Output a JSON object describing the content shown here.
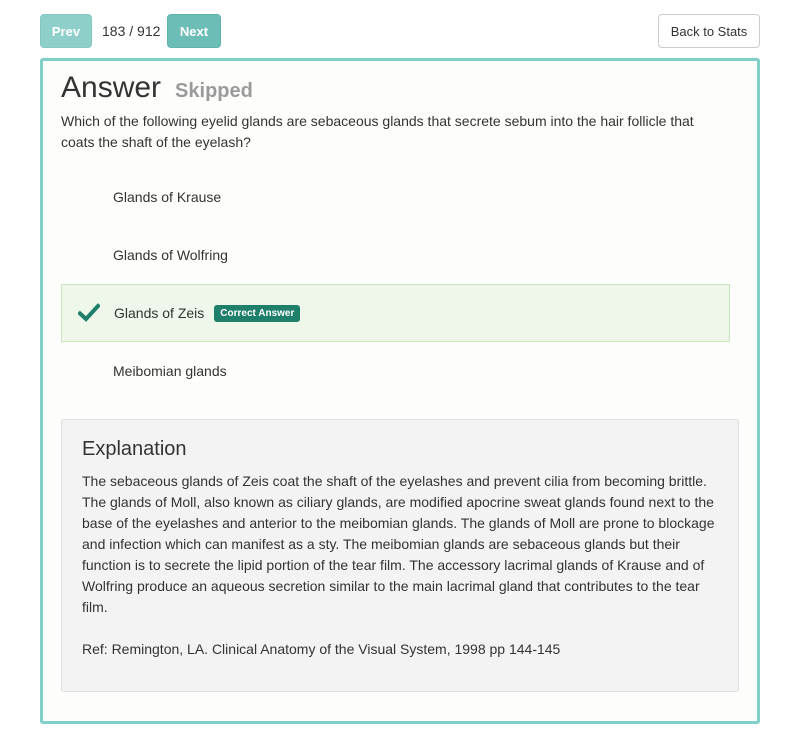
{
  "nav": {
    "prev_label": "Prev",
    "counter": "183 / 912",
    "next_label": "Next",
    "back_label": "Back to Stats"
  },
  "answer": {
    "title": "Answer",
    "status": "Skipped",
    "question": "Which of the following eyelid glands are sebaceous glands that secrete sebum into the hair follicle that coats the shaft of the eyelash?",
    "options": [
      {
        "label": "Glands of Krause",
        "correct": false
      },
      {
        "label": "Glands of Wolfring",
        "correct": false
      },
      {
        "label": "Glands of Zeis",
        "correct": true,
        "badge": "Correct Answer"
      },
      {
        "label": "Meibomian glands",
        "correct": false
      }
    ]
  },
  "explanation": {
    "heading": "Explanation",
    "body": "The sebaceous glands of Zeis coat the shaft of the eyelashes and prevent cilia from becoming brittle. The glands of Moll, also known as ciliary glands, are modified apocrine sweat glands found next to the base of the eyelashes and anterior to the meibomian glands. The glands of Moll are prone to blockage and infection which can manifest as a sty. The meibomian glands are sebaceous glands but their function is to secrete the lipid portion of the tear film. The accessory lacrimal glands of Krause and of Wolfring produce an aqueous secretion similar to the main lacrimal gland that contributes to the tear film.",
    "ref": "Ref: Remington, LA. Clinical Anatomy of the Visual System, 1998 pp 144-145"
  },
  "colors": {
    "accent": "#6cbdb6",
    "card_border": "#7fcfc8",
    "correct_bg": "#eef7ea",
    "badge_bg": "#1e7f6a",
    "check": "#1e7f6a"
  },
  "icons": {
    "check": "check-icon"
  }
}
